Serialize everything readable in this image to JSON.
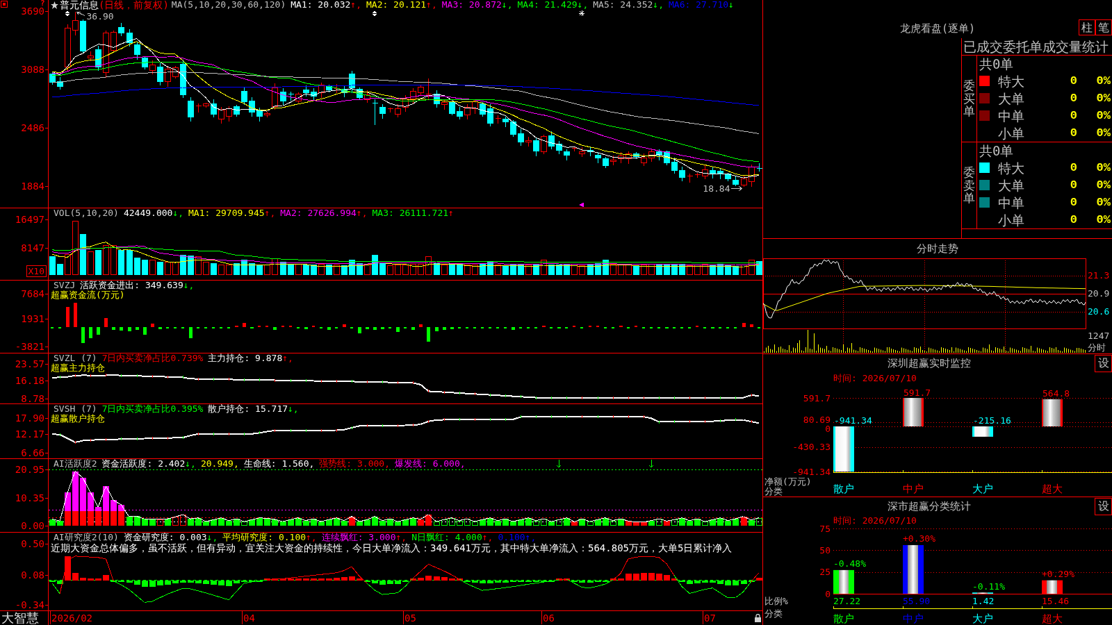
{
  "panels": [
    {
      "kind": "candles",
      "corner_mark": "?",
      "name": "普元信息",
      "period": "(日线，前复权)",
      "title": "MA(5,10,20,30,60,120)",
      "legend": [
        {
          "text": "MA1: 20.032",
          "color": "#ffffff",
          "arrow": "↑,",
          "up": true
        },
        {
          "text": "MA2: 20.121",
          "color": "#ffff00",
          "arrow": "↑,",
          "up": true
        },
        {
          "text": "MA3: 20.872",
          "color": "#ff00ff",
          "arrow": "↓,",
          "up": false
        },
        {
          "text": "MA4: 21.429",
          "color": "#00ff00",
          "arrow": "↓,",
          "up": false
        },
        {
          "text": "MA5: 24.352",
          "color": "#c0c0c0",
          "arrow": "↓,",
          "up": false
        },
        {
          "text": "MA6: 27.710",
          "color": "#0000ff",
          "arrow": "↓",
          "up": false
        }
      ],
      "y_axis": [
        "3690",
        "3088",
        "2486",
        "1884"
      ],
      "high_label": "36.90",
      "low_label": "18.84"
    },
    {
      "kind": "volume",
      "title": "VOL(5,10,20)",
      "legend": [
        {
          "text": "42449.000",
          "color": "#ffffff",
          "arrow": "↓,",
          "up": false
        },
        {
          "text": "MA1: 29709.945",
          "color": "#ffff00",
          "arrow": "↑,",
          "up": true
        },
        {
          "text": "MA2: 27626.994",
          "color": "#ff00ff",
          "arrow": "↑,",
          "up": true
        },
        {
          "text": "MA3: 26111.721",
          "color": "#00ff00",
          "arrow": "↑",
          "up": true
        }
      ],
      "y_axis": [
        "16497",
        "8147"
      ],
      "unit": "X10"
    },
    {
      "kind": "flow",
      "title": "SVZJ",
      "legend": [
        {
          "text": "活跃资金进出: 349.639",
          "color": "#ffffff",
          "arrow": "↓,",
          "up": false
        }
      ],
      "subtitle": "超赢资金流(万元)",
      "y_axis": [
        "7684",
        "1931",
        "-3821"
      ]
    },
    {
      "kind": "holding",
      "title": "SVZL (7)",
      "legend": [
        {
          "text": "7日内买卖净占比0.739%",
          "color": "#ff0000"
        },
        {
          "text": "主力持仓: 9.878",
          "color": "#ffffff",
          "arrow": "↑,",
          "up": true
        }
      ],
      "subtitle": "超赢主力持仓",
      "y_axis": [
        "23.57",
        "16.18",
        "8.78"
      ]
    },
    {
      "kind": "holding",
      "title": "SVSH (7)",
      "legend": [
        {
          "text": "7日内买卖净占比0.395%",
          "color": "#00ff00"
        },
        {
          "text": "散户持仓: 15.717",
          "color": "#ffffff",
          "arrow": "↓,",
          "up": false
        }
      ],
      "subtitle": "超赢散户持仓",
      "y_axis": [
        "17.90",
        "12.17",
        "6.66"
      ]
    },
    {
      "kind": "activity",
      "title": "AI活跃度2",
      "legend": [
        {
          "text": "资金活跃度: 2.402",
          "color": "#ffffff",
          "arrow": "↓,",
          "up": false
        },
        {
          "text": "20.949,",
          "color": "#ffff00"
        },
        {
          "text": "生命线: 1.560,",
          "color": "#ffffff"
        },
        {
          "text": "强势线: 3.000,",
          "color": "#ff0000"
        },
        {
          "text": "爆发线: 6.000,",
          "color": "#ff00ff"
        }
      ],
      "y_axis": [
        "20.95",
        "10.35",
        "0.00"
      ]
    },
    {
      "kind": "research",
      "title": "AI研究度2(10)",
      "legend": [
        {
          "text": "资金研究度: 0.003",
          "color": "#ffffff",
          "arrow": "↓,",
          "up": false
        },
        {
          "text": "平均研究度: 0.100",
          "color": "#ffff00",
          "arrow": "↑,",
          "up": true
        },
        {
          "text": "连续飘红: 3.000",
          "color": "#ff00ff",
          "arrow": "↑,",
          "up": true
        },
        {
          "text": "N日飘红: 4.000",
          "color": "#00ff00",
          "arrow": "↑,",
          "up": true
        },
        {
          "text": "0.100↑,",
          "color": "#0000ff"
        }
      ],
      "comment": "近期大资金总体偏多，虽不活跃，但有异动，宜关注大资金的持续性，今日大单净流入：349.641万元，其中特大单净流入：564.805万元，大单5日累计净入",
      "y_axis": [
        "0.50",
        "0.08",
        "-0.34"
      ]
    }
  ],
  "date_axis": {
    "brand": "大智慧",
    "dates": [
      "2026/02",
      "04",
      "05",
      "06",
      "07"
    ]
  },
  "order_stats": {
    "title": "龙虎看盘(逐单)",
    "buttons": [
      "柱",
      "笔"
    ],
    "heading": "已成交委托单成交量统计",
    "groups": [
      {
        "side": "委买单",
        "total": "共0单",
        "rows": [
          {
            "label": "特大",
            "count": "0",
            "percent": "0%",
            "color": "#ff0000"
          },
          {
            "label": "大单",
            "count": "0",
            "percent": "0%",
            "color": "#800000"
          },
          {
            "label": "中单",
            "count": "0",
            "percent": "0%",
            "color": "#800000"
          },
          {
            "label": "小单",
            "count": "0",
            "percent": "0%"
          }
        ]
      },
      {
        "side": "委卖单",
        "total": "共0单",
        "rows": [
          {
            "label": "特大",
            "count": "0",
            "percent": "0%",
            "color": "#00ffff"
          },
          {
            "label": "大单",
            "count": "0",
            "percent": "0%",
            "color": "#008080"
          },
          {
            "label": "中单",
            "count": "0",
            "percent": "0%",
            "color": "#008080"
          },
          {
            "label": "小单",
            "count": "0",
            "percent": "0%"
          }
        ]
      }
    ]
  },
  "intraday": {
    "title": "分时走势",
    "price_labels": [
      {
        "text": "21.3",
        "color": "#ff0000"
      },
      {
        "text": "20.9",
        "color": "#c0c0c0"
      },
      {
        "text": "20.6",
        "color": "#00ffff"
      }
    ],
    "volume_label": "1247",
    "unit_label": "分时"
  },
  "monitor": {
    "title": "深圳超赢实时监控",
    "settings": "设",
    "time": "时间: 2026/07/10",
    "chart_data": {
      "type": "bar",
      "ylabel": "净额(万元)",
      "xlabel": "分类",
      "categories": [
        "散户",
        "中户",
        "大户",
        "超大"
      ],
      "values": [
        -941.34,
        591.7,
        -215.16,
        564.8
      ],
      "ylim": [
        -941.34,
        591.7
      ],
      "yticks": [
        591.7,
        80.69,
        0,
        -430.33,
        -941.34
      ],
      "grid": true,
      "data_labels": true
    }
  },
  "classify": {
    "title": "深市超赢分类统计",
    "settings": "设",
    "time": "时间: 2026/07/10",
    "chart_data": {
      "type": "bar",
      "ylabel": "比例%",
      "xlabel": "分类",
      "categories": [
        "散户",
        "中户",
        "大户",
        "超大"
      ],
      "series": [
        {
          "color": "#00ff00",
          "values": [
            27.22,
            null,
            null,
            null
          ]
        },
        {
          "color": "#0000ff",
          "values": [
            null,
            55.9,
            null,
            null
          ]
        },
        {
          "color": "#00ffff",
          "values": [
            null,
            null,
            1.42,
            null
          ]
        },
        {
          "color": "#ff0000",
          "values": [
            null,
            null,
            null,
            15.46
          ]
        }
      ],
      "stacked": true,
      "ylim": [
        0,
        75
      ],
      "yticks": [
        0,
        25,
        50,
        75
      ],
      "grid": true,
      "value_labels": [
        "27.22",
        "55.90",
        "1.42",
        "15.46"
      ]
    },
    "changes": [
      {
        "text": "-0.48%",
        "color": "#00ff00"
      },
      {
        "text": "+0.30%",
        "color": "#ff0000"
      },
      {
        "text": "-0.11%",
        "color": "#00ff00"
      },
      {
        "text": "+0.29%",
        "color": "#ff0000"
      }
    ]
  }
}
